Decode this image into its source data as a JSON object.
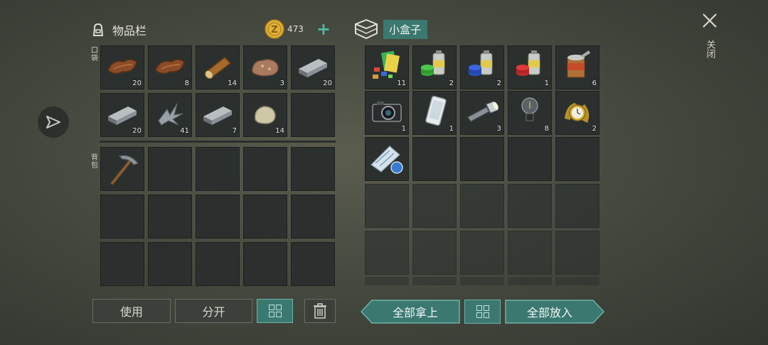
{
  "inventory": {
    "title": "物品栏",
    "coins": "473",
    "pocket_label": "口袋",
    "backpack_label": "背包",
    "pocket_items": [
      {
        "icon": "leather-icon",
        "count": "20"
      },
      {
        "icon": "leather-icon",
        "count": "8"
      },
      {
        "icon": "log-icon",
        "count": "14"
      },
      {
        "icon": "ore-icon",
        "count": "3"
      },
      {
        "icon": "metal-ingot-icon",
        "count": "20"
      },
      {
        "icon": "metal-ingot-icon",
        "count": "20"
      },
      {
        "icon": "metal-scrap-icon",
        "count": "41"
      },
      {
        "icon": "metal-ingot-icon",
        "count": "7"
      },
      {
        "icon": "stone-icon",
        "count": "14"
      },
      {
        "icon": "",
        "count": ""
      }
    ],
    "backpack_items": [
      {
        "icon": "pickaxe-icon",
        "count": ""
      }
    ]
  },
  "box": {
    "title": "小盒子",
    "items": [
      {
        "icon": "cards-icon",
        "count": "11"
      },
      {
        "icon": "green-spray-can-icon",
        "count": "2"
      },
      {
        "icon": "blue-spray-can-icon",
        "count": "2"
      },
      {
        "icon": "red-spray-can-icon",
        "count": "1"
      },
      {
        "icon": "food-can-icon",
        "count": "6"
      },
      {
        "icon": "camera-icon",
        "count": "1"
      },
      {
        "icon": "smartphone-icon",
        "count": "1"
      },
      {
        "icon": "flashlight-icon",
        "count": "3"
      },
      {
        "icon": "light-bulb-icon",
        "count": "8"
      },
      {
        "icon": "watch-icon",
        "count": "2"
      },
      {
        "icon": "map-roll-icon",
        "count": ""
      }
    ]
  },
  "buttons": {
    "use": "使用",
    "split": "分开",
    "take_all": "全部拿上",
    "put_all": "全部放入",
    "close": "关闭"
  },
  "colors": {
    "accent": "#3b7870",
    "coin": "#e0b23a",
    "slot": "#2b302f"
  }
}
